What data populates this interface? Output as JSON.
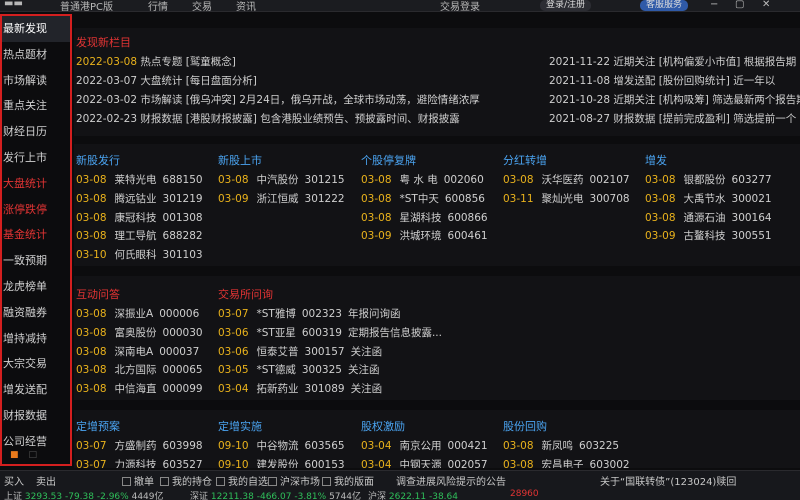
{
  "topbar": {
    "app_name": "普通港PC版",
    "menu": [
      "行情",
      "交易",
      "资讯"
    ],
    "search_label": "交易登录",
    "login_label": "登录/注册",
    "service_label": "客服服务",
    "win_min": "−",
    "win_max": "▢",
    "win_close": "✕"
  },
  "sidebar": {
    "items": [
      {
        "label": "最新发现",
        "state": "active"
      },
      {
        "label": "热点题材",
        "state": "normal"
      },
      {
        "label": "市场解读",
        "state": "normal"
      },
      {
        "label": "重点关注",
        "state": "normal"
      },
      {
        "label": "财经日历",
        "state": "normal"
      },
      {
        "label": "发行上市",
        "state": "normal"
      },
      {
        "label": "大盘统计",
        "state": "red"
      },
      {
        "label": "涨停跌停",
        "state": "red"
      },
      {
        "label": "基金统计",
        "state": "red"
      },
      {
        "label": "一致预期",
        "state": "normal"
      },
      {
        "label": "龙虎榜单",
        "state": "normal"
      },
      {
        "label": "融资融券",
        "state": "normal"
      },
      {
        "label": "增持减持",
        "state": "normal"
      },
      {
        "label": "大宗交易",
        "state": "normal"
      },
      {
        "label": "增发送配",
        "state": "normal"
      },
      {
        "label": "财报数据",
        "state": "normal"
      },
      {
        "label": "公司经营",
        "state": "normal"
      }
    ],
    "dot1": "■",
    "dot2": "□"
  },
  "discovery": {
    "title": "发现新栏目",
    "left": [
      {
        "date": "2022-03-08",
        "highlight": true,
        "text": "热点专题 [鹫童概念]"
      },
      {
        "date": "2022-03-07",
        "highlight": false,
        "text": "大盘统计 [每日盘面分析]"
      },
      {
        "date": "2022-03-02",
        "highlight": false,
        "text": "市场解读 [俄乌冲突] 2月24日，俄乌开战，全球市场动荡，避险情绪浓厚"
      },
      {
        "date": "2022-02-23",
        "highlight": false,
        "text": "财报数据 [港股财报披露] 包含港股业绩预告、预披露时间、财报披露"
      }
    ],
    "right": [
      {
        "date": "2021-11-22",
        "text": "近期关注 [机构偏爱小市值] 根据报告期"
      },
      {
        "date": "2021-11-08",
        "text": "增发送配 [股份回购统计] 近一年以"
      },
      {
        "date": "2021-10-28",
        "text": "近期关注 [机构吸筹] 筛选最新两个报告期"
      },
      {
        "date": "2021-08-27",
        "text": "财报数据 [提前完成盈利] 筛选提前一个"
      }
    ]
  },
  "sections": {
    "new_stock_issue": {
      "title": "新股发行",
      "rows": [
        {
          "date": "03-08",
          "name": "莱特光电",
          "code": "688150"
        },
        {
          "date": "03-08",
          "name": "腾远钴业",
          "code": "301219"
        },
        {
          "date": "03-08",
          "name": "康冠科技",
          "code": "001308"
        },
        {
          "date": "03-08",
          "name": "理工导航",
          "code": "688282"
        },
        {
          "date": "03-10",
          "name": "何氏眼科",
          "code": "301103"
        }
      ]
    },
    "new_stock_listing": {
      "title": "新股上市",
      "rows": [
        {
          "date": "03-08",
          "name": "中汽股份",
          "code": "301215"
        },
        {
          "date": "03-09",
          "name": "浙江恒威",
          "code": "301222"
        }
      ]
    },
    "suspension": {
      "title": "个股停复牌",
      "rows": [
        {
          "date": "03-08",
          "name": "粤 水 电",
          "code": "002060"
        },
        {
          "date": "03-08",
          "name": "*ST中天",
          "code": "600856"
        },
        {
          "date": "03-08",
          "name": "星湖科技",
          "code": "600866"
        },
        {
          "date": "03-09",
          "name": "洪城环境",
          "code": "600461"
        }
      ]
    },
    "dividend": {
      "title": "分红转增",
      "rows": [
        {
          "date": "03-08",
          "name": "沃华医药",
          "code": "002107"
        },
        {
          "date": "03-11",
          "name": "聚灿光电",
          "code": "300708"
        }
      ]
    },
    "additional_issue": {
      "title": "增发",
      "rows": [
        {
          "date": "03-08",
          "name": "银都股份",
          "code": "603277"
        },
        {
          "date": "03-08",
          "name": "大禹节水",
          "code": "300021"
        },
        {
          "date": "03-08",
          "name": "通源石油",
          "code": "300164"
        },
        {
          "date": "03-09",
          "name": "古鳌科技",
          "code": "300551"
        }
      ]
    },
    "interactive_qa": {
      "title": "互动问答",
      "rows": [
        {
          "date": "03-08",
          "name": "深振业A",
          "code": "000006"
        },
        {
          "date": "03-08",
          "name": "富奥股份",
          "code": "000030"
        },
        {
          "date": "03-08",
          "name": "深南电A",
          "code": "000037"
        },
        {
          "date": "03-08",
          "name": "北方国际",
          "code": "000065"
        },
        {
          "date": "03-08",
          "name": "中信海直",
          "code": "000099"
        }
      ]
    },
    "exchange_inquiry": {
      "title": "交易所问询",
      "rows": [
        {
          "date": "03-07",
          "name": "*ST雅博",
          "code": "002323",
          "note": "年报问询函"
        },
        {
          "date": "03-06",
          "name": "*ST亚星",
          "code": "600319",
          "note": "定期报告信息披露..."
        },
        {
          "date": "03-06",
          "name": "恒泰艾普",
          "code": "300157",
          "note": "关注函"
        },
        {
          "date": "03-05",
          "name": "*ST德威",
          "code": "300325",
          "note": "关注函"
        },
        {
          "date": "03-04",
          "name": "拓新药业",
          "code": "301089",
          "note": "关注函"
        }
      ]
    },
    "placement_plan": {
      "title": "定增预案",
      "rows": [
        {
          "date": "03-07",
          "name": "方盛制药",
          "code": "603998"
        },
        {
          "date": "03-07",
          "name": "力源科技",
          "code": "603527"
        }
      ]
    },
    "placement_impl": {
      "title": "定增实施",
      "rows": [
        {
          "date": "09-10",
          "name": "中谷物流",
          "code": "603565"
        },
        {
          "date": "09-10",
          "name": "建发股份",
          "code": "600153"
        }
      ]
    },
    "equity_incentive": {
      "title": "股权激励",
      "rows": [
        {
          "date": "03-04",
          "name": "南京公用",
          "code": "000421"
        },
        {
          "date": "03-04",
          "name": "中钢天源",
          "code": "002057"
        }
      ]
    },
    "buyback": {
      "title": "股份回购",
      "rows": [
        {
          "date": "03-08",
          "name": "新凤鸣",
          "code": "603225"
        },
        {
          "date": "03-08",
          "name": "宏昌电子",
          "code": "603002"
        }
      ]
    }
  },
  "bottombar": {
    "items": [
      "买入",
      "卖出",
      "撤单",
      "我的持仓",
      "我的自选",
      "沪深市场",
      "我的版面",
      "调查进展风险提示的公告",
      "关于“国联转债”(123024)赎回"
    ],
    "tickers": [
      {
        "label": "上证",
        "value": "3293.53",
        "change": "-79.38",
        "pct": "-2.96%",
        "vol": "4449亿",
        "dir": "dn"
      },
      {
        "label": "深证",
        "value": "12211.38",
        "change": "-466.07",
        "pct": "-3.81%",
        "vol": "5744亿",
        "dir": "dn"
      },
      {
        "label": "沪深",
        "value": "2622.11",
        "change": "-38.64",
        "pct": "",
        "vol": "",
        "dir": "dn"
      },
      {
        "label": "",
        "value": "28960",
        "change": "",
        "pct": "",
        "vol": "",
        "dir": "up"
      }
    ]
  }
}
